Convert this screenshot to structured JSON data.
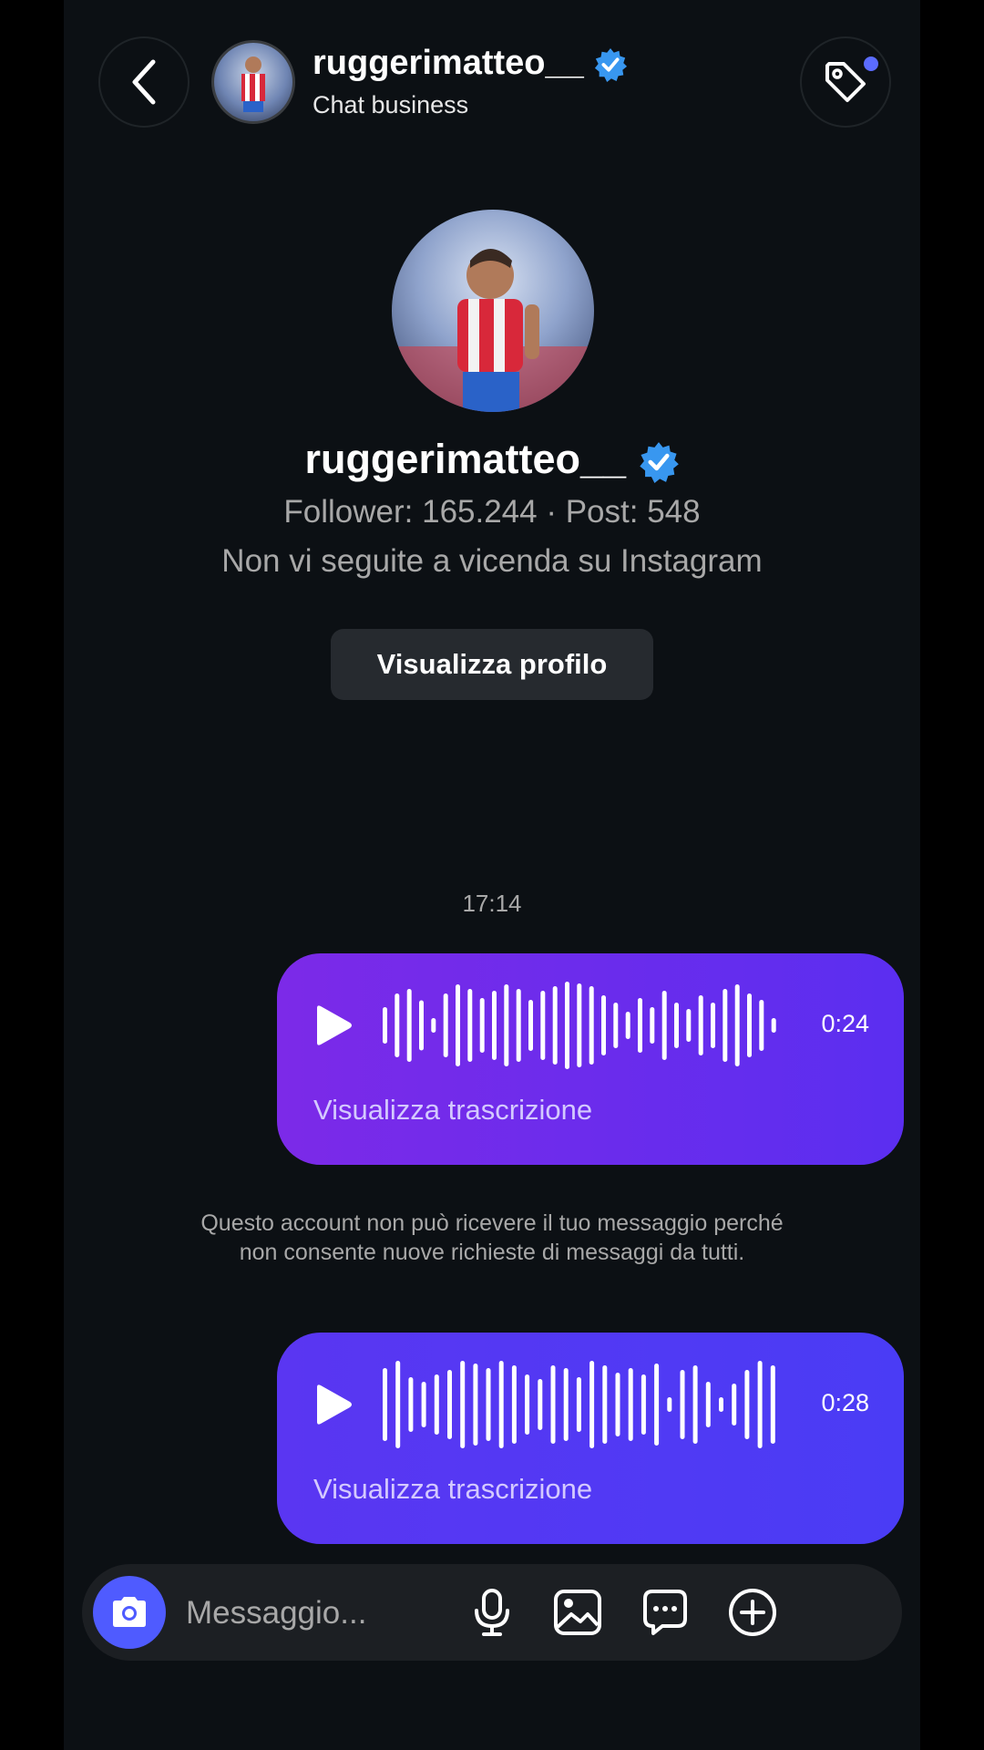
{
  "header": {
    "username": "ruggerimatteo__",
    "subtitle": "Chat business"
  },
  "profile": {
    "username": "ruggerimatteo__",
    "stats": "Follower: 165.244 · Post: 548",
    "follow_status": "Non vi seguite a vicenda su Instagram",
    "view_profile_label": "Visualizza profilo"
  },
  "messages": {
    "timestamp": "17:14",
    "voice": [
      {
        "duration": "0:24",
        "transcript_label": "Visualizza trascrizione"
      },
      {
        "duration": "0:28",
        "transcript_label": "Visualizza trascrizione"
      }
    ],
    "notice": "Questo account non può ricevere il tuo messaggio perché non consente nuove richieste di messaggi da tutti."
  },
  "composer": {
    "placeholder": "Messaggio..."
  },
  "colors": {
    "background": "#0c1014",
    "accent": "#4f5bff",
    "verified": "#3897f0",
    "bubble_start": "#7c2ae8",
    "bubble_end": "#4a3cf5"
  },
  "icons": [
    "chevron-left-icon",
    "tag-icon",
    "verified-badge-icon",
    "play-icon",
    "waveform-icon",
    "camera-icon",
    "microphone-icon",
    "gallery-icon",
    "sticker-icon",
    "plus-circle-icon"
  ]
}
